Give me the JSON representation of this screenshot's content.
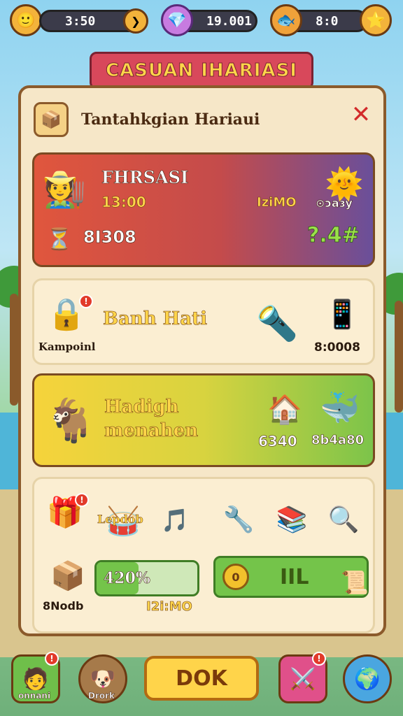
{
  "topbar": {
    "timer1": "3:50",
    "gems": "19.001",
    "timer2": "8:0",
    "icons": [
      "avatar-icon",
      "coin-icon",
      "gem-icon",
      "fish-icon",
      "star-icon"
    ]
  },
  "title_ribbon": "CASUAN IHARIASI",
  "panel": {
    "title": "Tantahkgian Hariaui",
    "close_label": "✕"
  },
  "card1": {
    "name": "FHRSASI",
    "time": "13:00",
    "count": "8I308",
    "label_right": "IziMO",
    "bonus": "⊙ɔaɜy",
    "multiplier": "?.4#"
  },
  "card2": {
    "item_label": "Kampoinl",
    "title": "Banh Hati",
    "reward_value": "8:0008"
  },
  "card3": {
    "title_line1": "Hadigh",
    "title_line2": "menahen",
    "reward1": "6340",
    "reward2": "8b4a80"
  },
  "card4": {
    "tag": "Lepdob",
    "progress_text": "420%",
    "progress_fraction": 0.42,
    "item_label": "8Nodb",
    "secondary_value": "I2i:MO",
    "action_button": "IIL",
    "coin_symbol": "0"
  },
  "bottom": {
    "left_label": "onnani",
    "second_label": "Drork",
    "ok_label": "DOK"
  },
  "colors": {
    "accent": "#ffd54a",
    "ribbon": "#d8485b",
    "panel_bg": "#f6e7c8",
    "border": "#8b5a2b"
  }
}
